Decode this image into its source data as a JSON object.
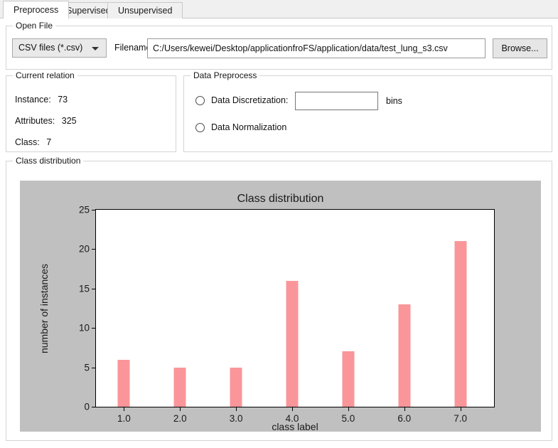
{
  "tabs": [
    {
      "label": "Preprocess",
      "active": true
    },
    {
      "label": "Supervised",
      "active": false
    },
    {
      "label": "Unsupervised",
      "active": false
    }
  ],
  "open_file": {
    "group_label": "Open File",
    "filetype_value": "CSV files (*.csv)",
    "filename_label": "Filename:",
    "filename_value": "C:/Users/kewei/Desktop/applicationfroFS/application/data/test_lung_s3.csv",
    "filename_placeholder": "",
    "browse_label": "Browse..."
  },
  "current_relation": {
    "group_label": "Current relation",
    "instance_key": "Instance:",
    "instance_value": "73",
    "attributes_key": "Attributes:",
    "attributes_value": "325",
    "class_key": "Class:",
    "class_value": "7"
  },
  "data_preprocess": {
    "group_label": "Data Preprocess",
    "discretization_label": "Data Discretization:",
    "discretization_checked": false,
    "bins_value": "",
    "bins_placeholder": "",
    "bins_suffix": "bins",
    "normalization_label": "Data Normalization",
    "normalization_checked": false
  },
  "class_distribution": {
    "group_label": "Class distribution"
  },
  "colors": {
    "bar": "#fa9699",
    "figure_background": "#c0c0c0",
    "plot_background": "#ffffff",
    "window_background": "#ffffff"
  },
  "chart_data": {
    "type": "bar",
    "title": "Class distribution",
    "xlabel": "class label",
    "ylabel": "number of instances",
    "categories": [
      "1.0",
      "2.0",
      "3.0",
      "4.0",
      "5.0",
      "6.0",
      "7.0"
    ],
    "x": [
      1.0,
      2.0,
      3.0,
      4.0,
      5.0,
      6.0,
      7.0
    ],
    "values": [
      6,
      5,
      5,
      16,
      7,
      13,
      21
    ],
    "ylim": [
      0,
      25
    ],
    "yticks": [
      0,
      5,
      10,
      15,
      20,
      25
    ],
    "xlim": [
      0.5,
      7.6
    ],
    "grid": false,
    "legend": false,
    "bar_color": "#fa9699"
  }
}
